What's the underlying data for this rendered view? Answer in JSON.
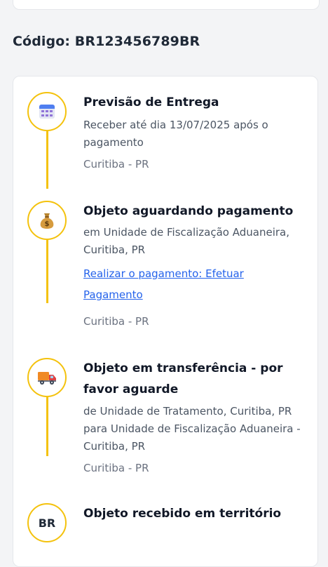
{
  "tracking": {
    "code_label": "Código: BR123456789BR"
  },
  "events": [
    {
      "icon": "calendar-icon",
      "title": "Previsão de Entrega",
      "description": "Receber até dia 13/07/2025 após o pagamento",
      "location": "Curitiba - PR"
    },
    {
      "icon": "money-bag-icon",
      "title": "Objeto aguardando pagamento",
      "description": "em Unidade de Fiscalização Aduaneira, Curitiba, PR",
      "link": "Realizar o pagamento: Efetuar Pagamento",
      "location": "Curitiba - PR"
    },
    {
      "icon": "delivery-truck-icon",
      "title": "Objeto em transferência - por favor aguarde",
      "description": "de Unidade de Tratamento, Curitiba, PR para Unidade de Fiscalização Aduaneira - Curitiba, PR",
      "location": "Curitiba - PR"
    },
    {
      "icon_text": "BR",
      "title": "Objeto recebido em território"
    }
  ],
  "colors": {
    "accent": "#f4c20d",
    "link": "#2563eb",
    "muted": "#6b7280"
  }
}
